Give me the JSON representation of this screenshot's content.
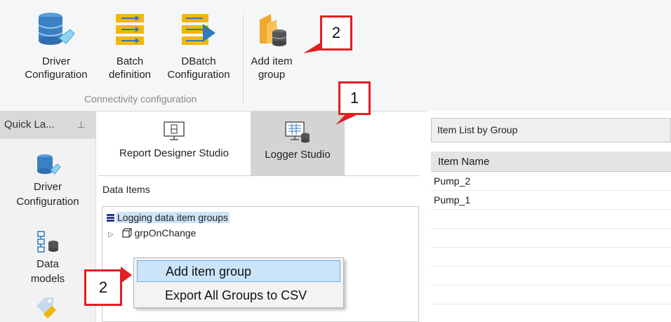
{
  "ribbon": {
    "buttons": [
      {
        "line1": "Driver",
        "line2": "Configuration"
      },
      {
        "line1": "Batch",
        "line2": "definition"
      },
      {
        "line1": "DBatch",
        "line2": "Configuration"
      },
      {
        "line1": "Add item",
        "line2": "group"
      }
    ],
    "group_label": "Connectivity configuration"
  },
  "quick_launch": {
    "title": "Quick La...",
    "items": [
      {
        "line1": "Driver",
        "line2": "Configuration"
      },
      {
        "line1": "Data",
        "line2": "models"
      }
    ]
  },
  "studio_tabs": [
    "Report Designer Studio",
    "Logger Studio"
  ],
  "data_items": {
    "label": "Data Items",
    "tree": {
      "root": "Logging data item groups",
      "children": [
        "grpOnChange"
      ]
    }
  },
  "item_list": {
    "title": "Item List by Group",
    "column": "Item Name",
    "rows": [
      "Pump_2",
      "Pump_1"
    ]
  },
  "context_menu": {
    "items": [
      "Add item group",
      "Export All Groups to CSV"
    ]
  },
  "callouts": [
    "2",
    "1",
    "2"
  ],
  "colors": {
    "accent": "#e31e24",
    "highlight": "#cce4f7"
  }
}
